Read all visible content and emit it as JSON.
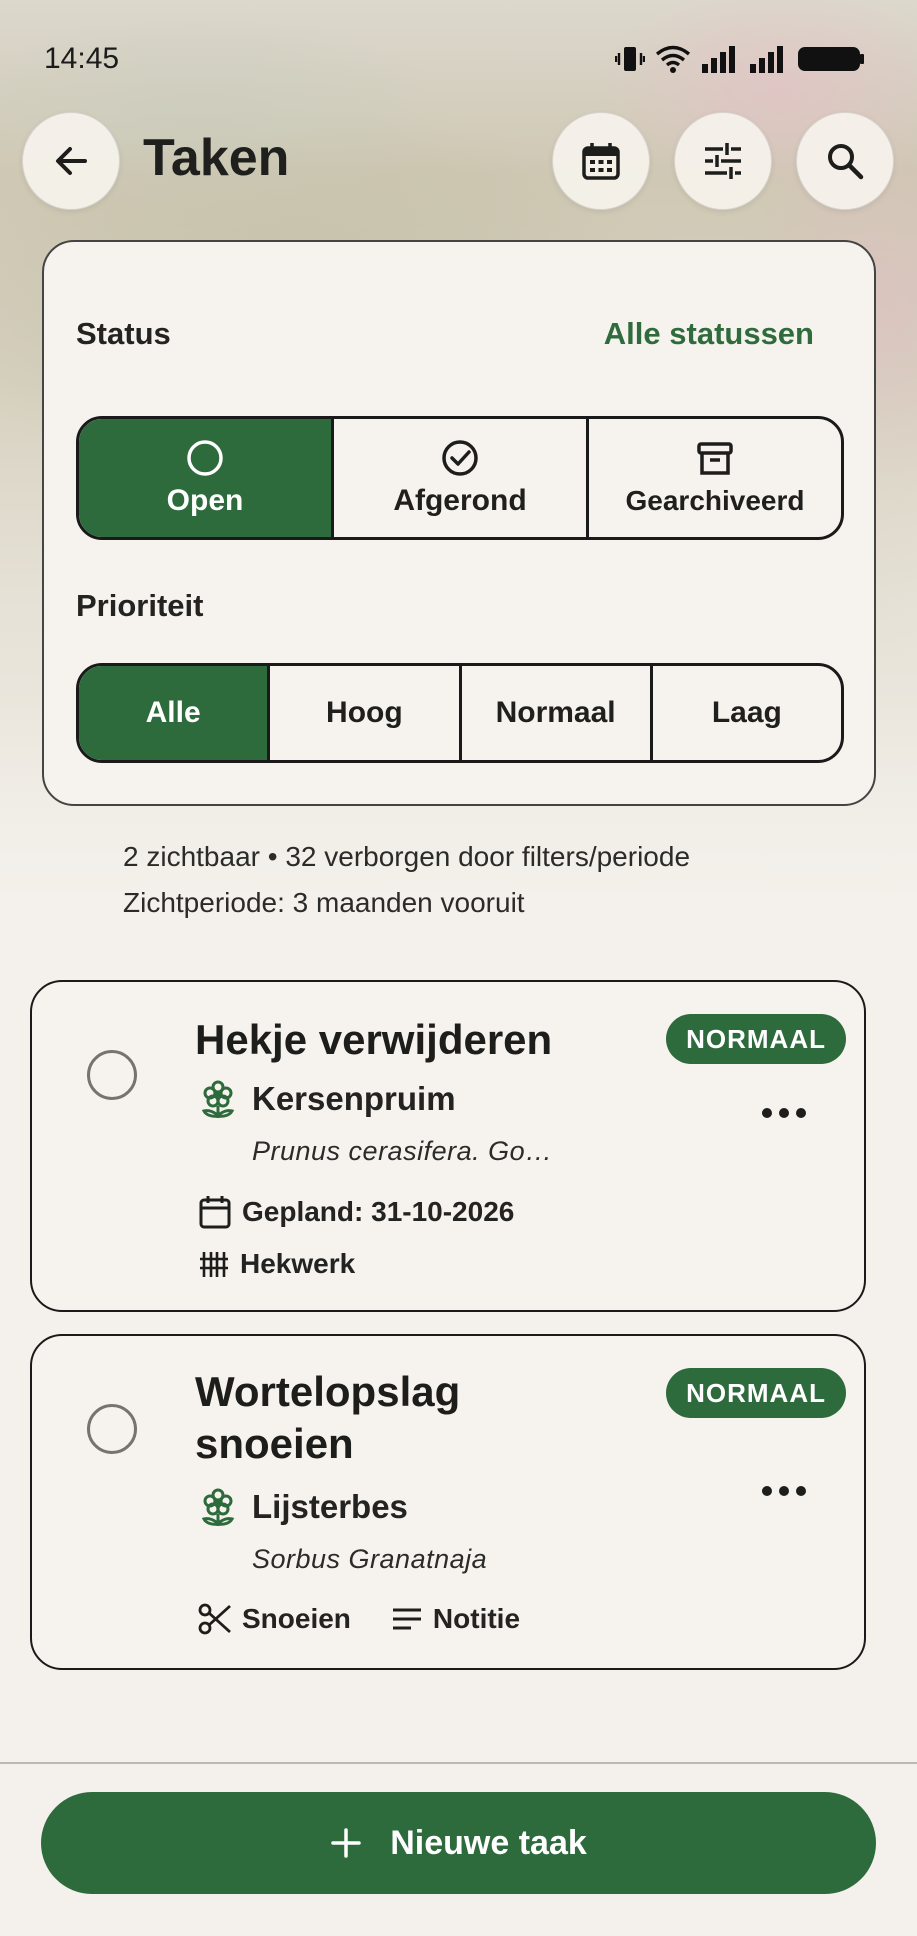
{
  "status_bar": {
    "time": "14:45"
  },
  "header": {
    "title": "Taken",
    "back_icon": "arrow-left-icon",
    "actions": [
      "calendar-icon",
      "sliders-icon",
      "search-icon"
    ]
  },
  "filters": {
    "status_label": "Status",
    "status_all_link": "Alle statussen",
    "status_options": [
      {
        "label": "Open",
        "icon": "circle-icon",
        "active": true
      },
      {
        "label": "Afgerond",
        "icon": "check-circle-icon",
        "active": false
      },
      {
        "label": "Gearchiveerd",
        "icon": "archive-icon",
        "active": false
      }
    ],
    "priority_label": "Prioriteit",
    "priority_options": [
      {
        "label": "Alle",
        "active": true
      },
      {
        "label": "Hoog",
        "active": false
      },
      {
        "label": "Normaal",
        "active": false
      },
      {
        "label": "Laag",
        "active": false
      }
    ]
  },
  "summary": {
    "visible_line": "2 zichtbaar • 32 verborgen door filters/periode",
    "period_line": "Zichtperiode: 3 maanden vooruit"
  },
  "tasks": [
    {
      "title": "Hekje verwijderen",
      "priority": "NORMAAL",
      "plant": "Kersenpruim",
      "latin": "Prunus cerasifera. Go…",
      "meta": [
        {
          "icon": "calendar-icon",
          "text": "Gepland: 31-10-2026"
        },
        {
          "icon": "fence-icon",
          "text": "Hekwerk"
        }
      ]
    },
    {
      "title_line1": "Wortelopslag",
      "title_line2": "snoeien",
      "priority": "NORMAAL",
      "plant": "Lijsterbes",
      "latin": "Sorbus Granatnaja",
      "meta": [
        {
          "icon": "scissors-icon",
          "text": "Snoeien"
        },
        {
          "icon": "notes-icon",
          "text": "Notitie"
        }
      ]
    }
  ],
  "footer": {
    "new_task_label": "Nieuwe taak",
    "icon": "plus-icon"
  },
  "colors": {
    "accent": "#2d6a3c",
    "background": "#f4f1ec",
    "text": "#1d1d1b"
  }
}
